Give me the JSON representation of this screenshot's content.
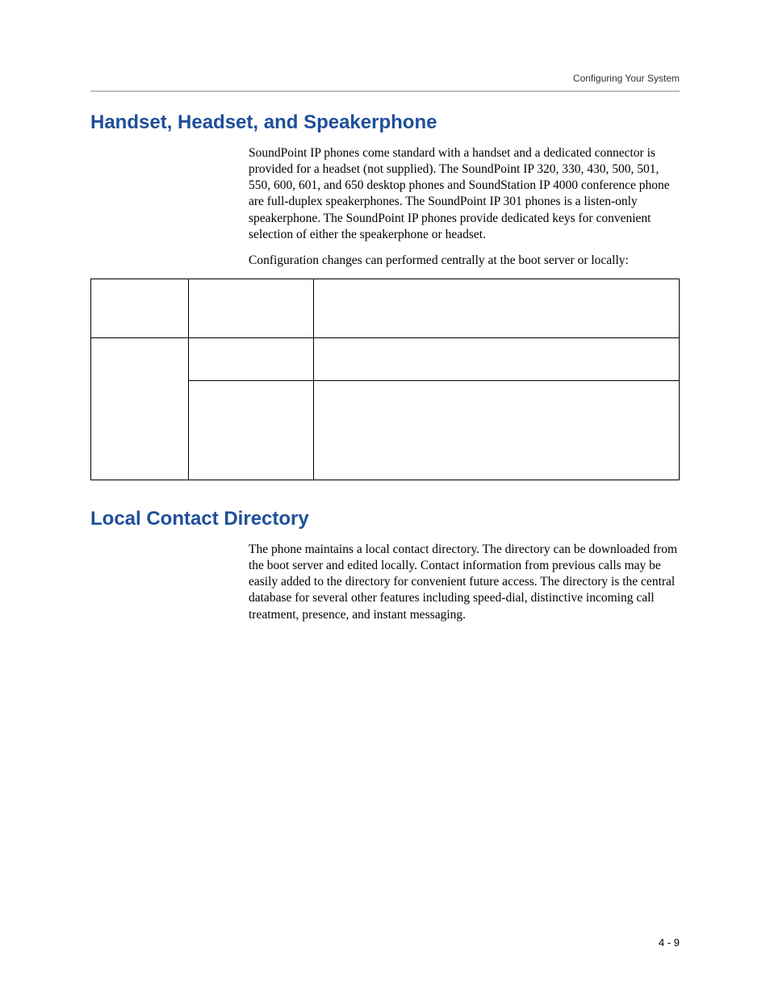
{
  "header": {
    "running": "Configuring Your System"
  },
  "sections": {
    "handset": {
      "title": "Handset, Headset, and Speakerphone",
      "p1": "SoundPoint IP phones come standard with a handset and a dedicated connector is provided for a headset (not supplied). The SoundPoint IP 320, 330, 430, 500, 501, 550, 600, 601, and 650 desktop phones and SoundStation IP 4000 conference phone are full-duplex speakerphones. The SoundPoint IP 301 phones is a listen-only speakerphone. The SoundPoint IP phones provide dedicated keys for convenient selection of either the speakerphone or headset.",
      "p2": "Configuration changes can performed centrally at the boot server or locally:"
    },
    "localdir": {
      "title": "Local Contact Directory",
      "p1": "The phone maintains a local contact directory. The directory can be downloaded from the boot server and edited locally. Contact information from previous calls may be easily added to the directory for convenient future access. The directory is the central database for several other features including speed-dial, distinctive incoming call treatment, presence, and instant messaging."
    }
  },
  "footer": {
    "page_number": "4 - 9"
  }
}
